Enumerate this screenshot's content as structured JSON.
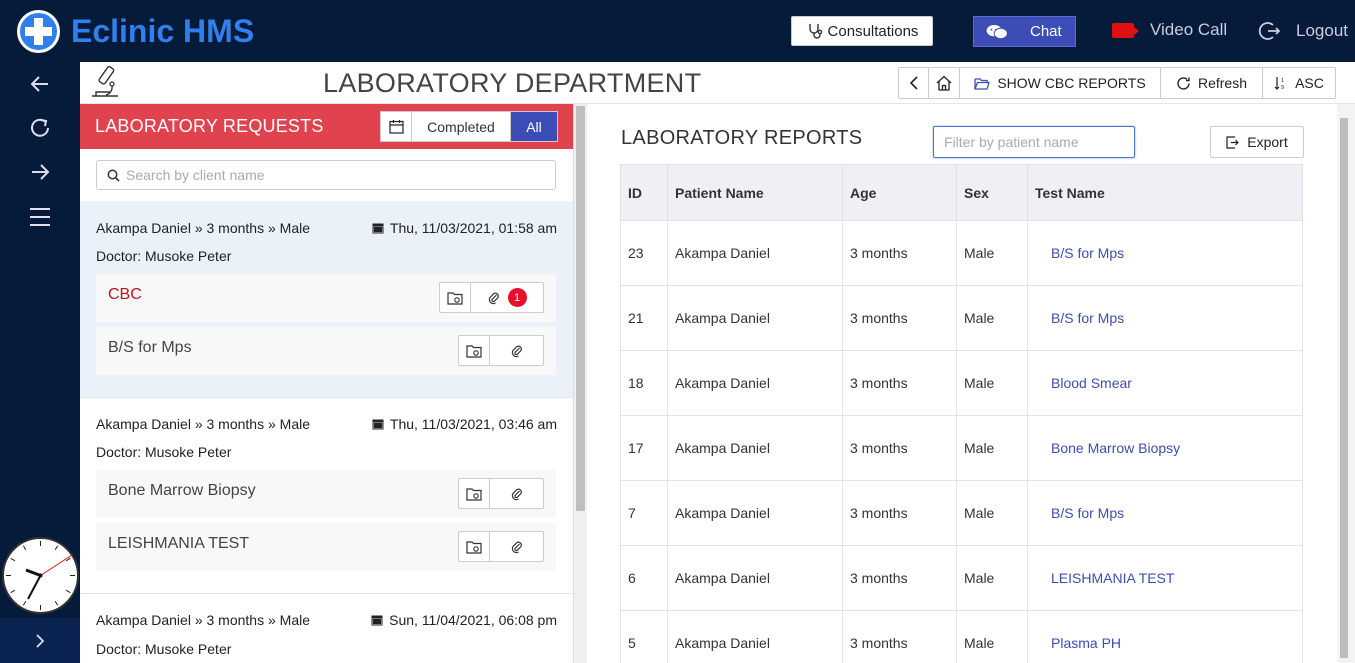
{
  "app": {
    "title": "Eclinic HMS"
  },
  "topbar": {
    "consultations_label": "Consultations",
    "chat_label": "Chat",
    "video_call_label": "Video Call",
    "logout_label": "Logout"
  },
  "header": {
    "title": "LABORATORY DEPARTMENT",
    "show_reports_label": "SHOW CBC REPORTS",
    "refresh_label": "Refresh",
    "sort_label": "ASC"
  },
  "requests": {
    "title": "LABORATORY REQUESTS",
    "filter_completed": "Completed",
    "filter_all": "All",
    "search_placeholder": "Search by client name",
    "items": [
      {
        "patient": "Akampa Daniel » 3 months » Male",
        "date": "Thu, 11/03/2021, 01:58 am",
        "doctor": "Doctor: Musoke Peter",
        "tests": [
          {
            "name": "CBC",
            "badge": "1"
          },
          {
            "name": "B/S for Mps"
          }
        ]
      },
      {
        "patient": "Akampa Daniel » 3 months » Male",
        "date": "Thu, 11/03/2021, 03:46 am",
        "doctor": "Doctor: Musoke Peter",
        "tests": [
          {
            "name": "Bone Marrow Biopsy"
          },
          {
            "name": "LEISHMANIA TEST"
          }
        ]
      },
      {
        "patient": "Akampa Daniel » 3 months » Male",
        "date": "Sun, 11/04/2021, 06:08 pm",
        "doctor": "Doctor: Musoke Peter"
      }
    ]
  },
  "reports": {
    "title": "LABORATORY REPORTS",
    "filter_placeholder": "Filter by patient name",
    "export_label": "Export",
    "columns": [
      "ID",
      "Patient Name",
      "Age",
      "Sex",
      "Test Name"
    ],
    "rows": [
      [
        "23",
        "Akampa Daniel",
        "3 months",
        "Male",
        "B/S for Mps"
      ],
      [
        "21",
        "Akampa Daniel",
        "3 months",
        "Male",
        "B/S for Mps"
      ],
      [
        "18",
        "Akampa Daniel",
        "3 months",
        "Male",
        "Blood Smear"
      ],
      [
        "17",
        "Akampa Daniel",
        "3 months",
        "Male",
        "Bone Marrow Biopsy"
      ],
      [
        "7",
        "Akampa Daniel",
        "3 months",
        "Male",
        "B/S for Mps"
      ],
      [
        "6",
        "Akampa Daniel",
        "3 months",
        "Male",
        "LEISHMANIA TEST"
      ],
      [
        "5",
        "Akampa Daniel",
        "3 months",
        "Male",
        "Plasma PH"
      ]
    ]
  },
  "icons": {
    "logo": "medical-cross-icon",
    "back": "arrow-left-icon",
    "reload": "refresh-icon",
    "forward": "arrow-right-icon",
    "menu": "hamburger-icon",
    "expand": "chevron-right-icon",
    "microscope": "microscope-icon"
  },
  "colors": {
    "topbar": "#061a3a",
    "brand": "#2f80ed",
    "accent": "#3d4db7",
    "requests_header": "#e0424e",
    "selected_test": "#c0121b",
    "badge": "#e8102a"
  }
}
